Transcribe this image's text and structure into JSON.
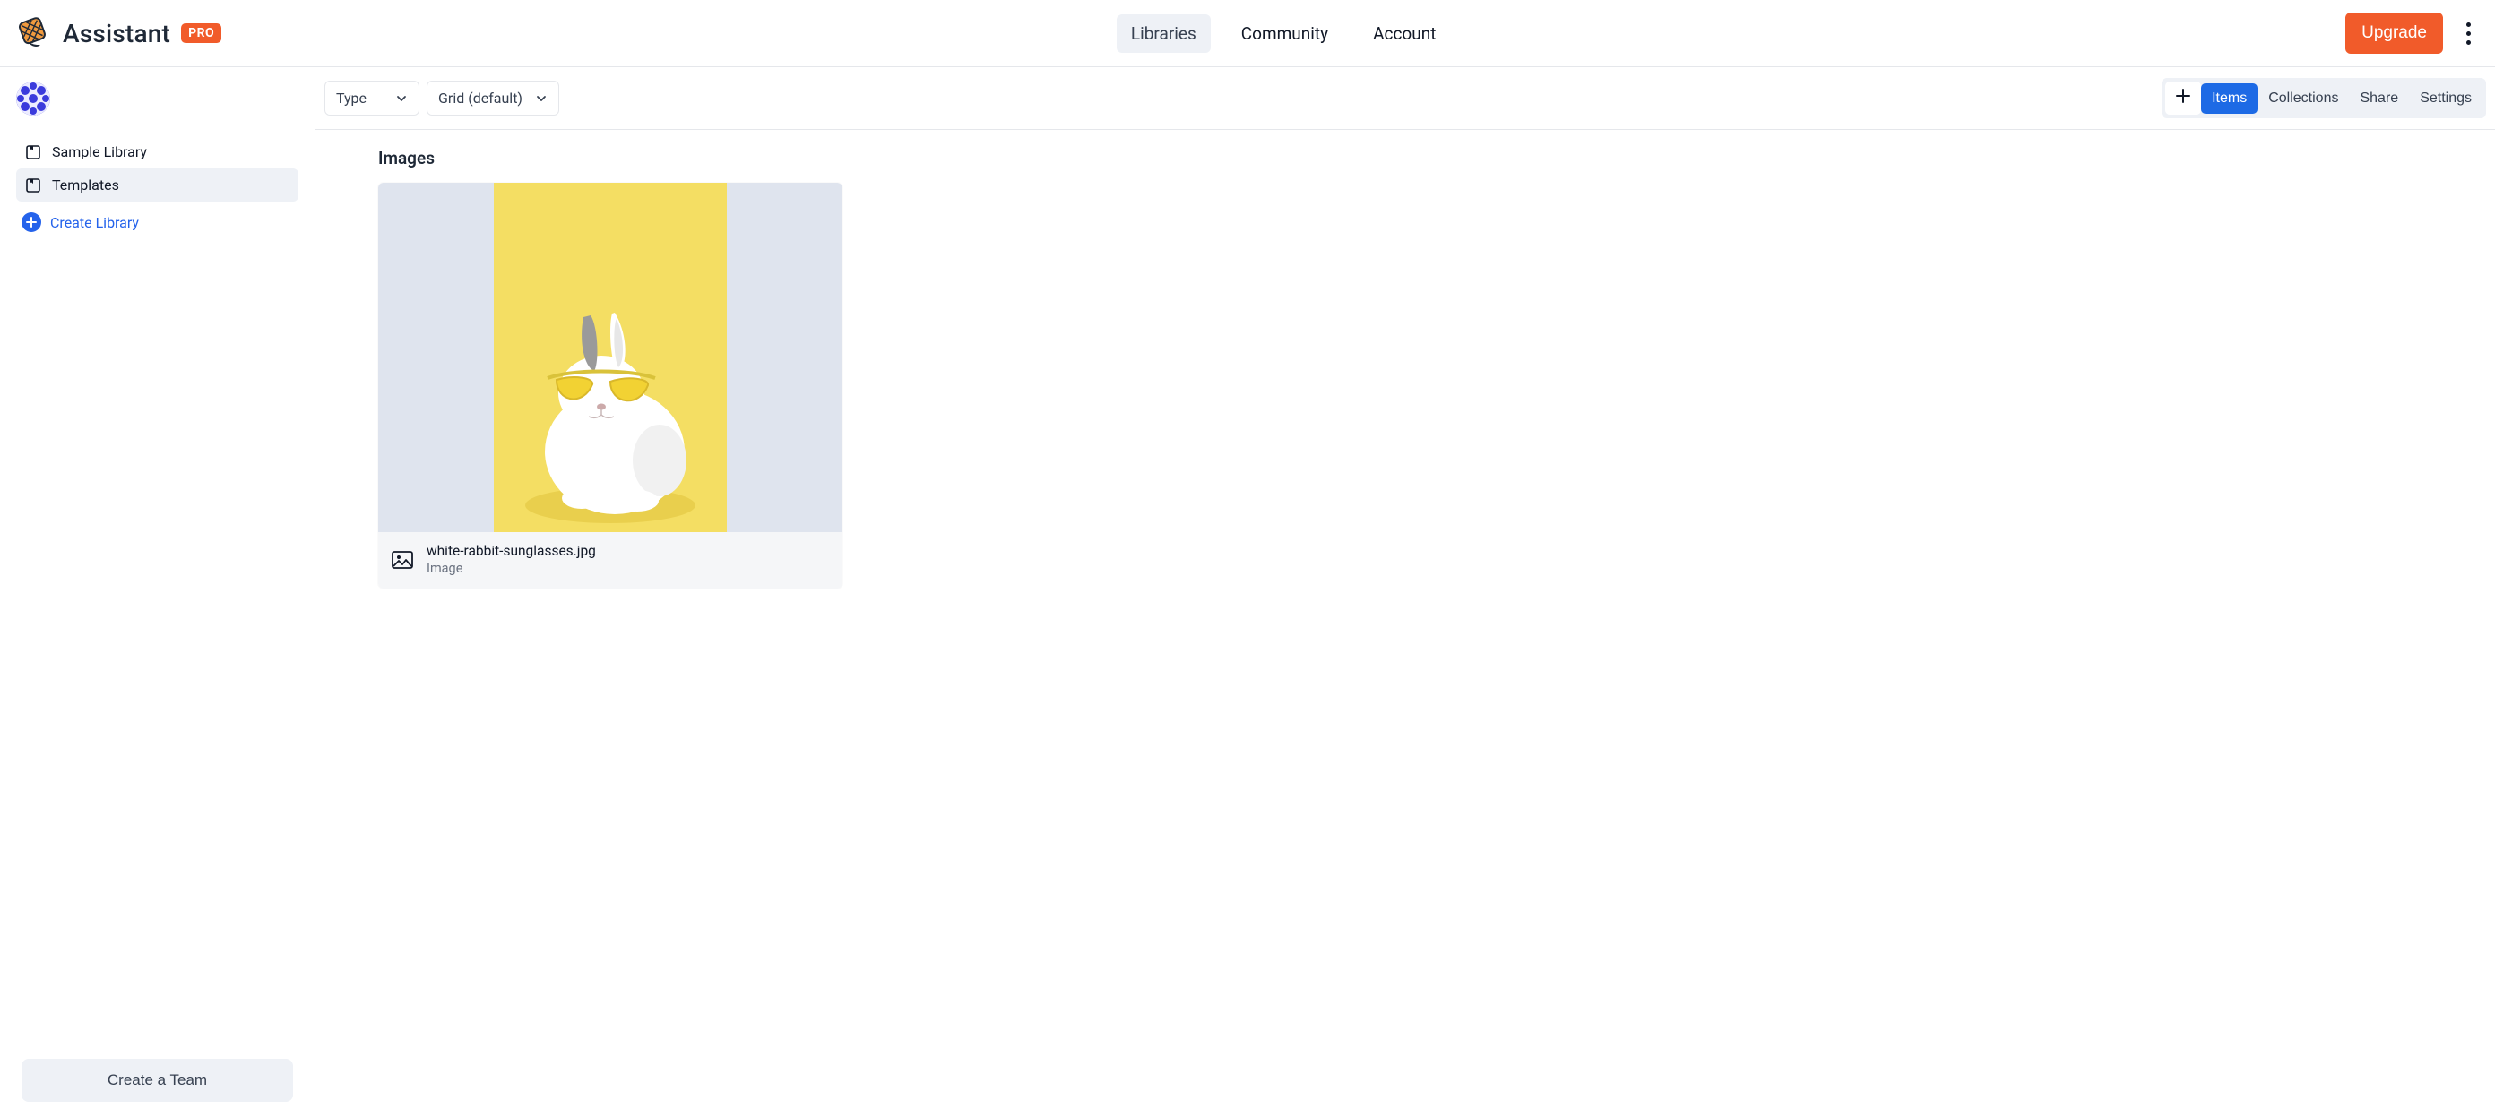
{
  "header": {
    "brand_name": "Assistant",
    "pro_badge": "PRO",
    "nav": [
      {
        "label": "Libraries",
        "active": true
      },
      {
        "label": "Community",
        "active": false
      },
      {
        "label": "Account",
        "active": false
      }
    ],
    "upgrade_label": "Upgrade"
  },
  "sidebar": {
    "libraries": [
      {
        "label": "Sample Library",
        "active": false
      },
      {
        "label": "Templates",
        "active": true
      }
    ],
    "create_library_label": "Create Library",
    "create_team_label": "Create a Team"
  },
  "toolbar": {
    "type_label": "Type",
    "view_label": "Grid (default)",
    "tabs": {
      "items": "Items",
      "collections": "Collections",
      "share": "Share",
      "settings": "Settings"
    }
  },
  "main": {
    "section_title": "Images",
    "items": [
      {
        "file_name": "white-rabbit-sunglasses.jpg",
        "kind": "Image"
      }
    ]
  }
}
